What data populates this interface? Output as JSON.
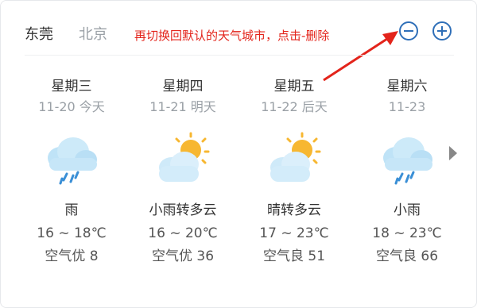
{
  "tabs": [
    {
      "label": "东莞",
      "active": true
    },
    {
      "label": "北京",
      "active": false
    }
  ],
  "annotation": "再切换回默认的天气城市，点击-删除",
  "colors": {
    "accent": "#2f6fb8",
    "annotation": "#e3241b"
  },
  "forecast": [
    {
      "weekday": "星期三",
      "date": "11-20 今天",
      "icon": "rain-cloud-icon",
      "condition": "雨",
      "temp": "16 ~ 18℃",
      "air": "空气优 8"
    },
    {
      "weekday": "星期四",
      "date": "11-21 明天",
      "icon": "sun-cloud-icon",
      "condition": "小雨转多云",
      "temp": "16 ~ 20℃",
      "air": "空气优 36"
    },
    {
      "weekday": "星期五",
      "date": "11-22 后天",
      "icon": "sun-cloud-icon",
      "condition": "晴转多云",
      "temp": "17 ~ 23℃",
      "air": "空气良 51"
    },
    {
      "weekday": "星期六",
      "date": "11-23",
      "icon": "rain-cloud-icon",
      "condition": "小雨",
      "temp": "18 ~ 23℃",
      "air": "空气良 66"
    }
  ]
}
